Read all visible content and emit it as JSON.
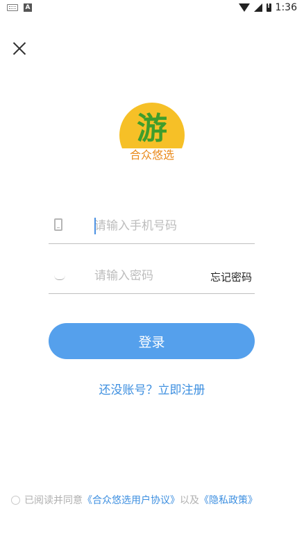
{
  "status_bar": {
    "time": "1:36",
    "icons": [
      "keyboard-icon",
      "a-icon",
      "wifi-icon",
      "signal-icon",
      "battery-alert-icon"
    ]
  },
  "header": {
    "close_icon": "close-icon"
  },
  "logo": {
    "glyph": "游",
    "brand_name": "合众悠选",
    "colors": {
      "sun": "#f6c027",
      "glyph": "#3f9d2c",
      "brand_text": "#e98a1c"
    }
  },
  "form": {
    "phone": {
      "placeholder": "请输入手机号码",
      "value": "",
      "icon": "phone-icon"
    },
    "password": {
      "placeholder": "请输入密码",
      "value": "",
      "icon": "eye-closed-icon",
      "forgot_label": "忘记密码"
    }
  },
  "login_button": {
    "label": "登录",
    "color": "#55a0ec"
  },
  "register_link": {
    "label": "还没账号？立即注册"
  },
  "agreement": {
    "prefix": "已阅读并同意",
    "user_agreement": "《合众悠选用户协议》",
    "conjunction": "以及",
    "privacy_policy": "《隐私政策》"
  },
  "accent_color": "#3d8fe0"
}
